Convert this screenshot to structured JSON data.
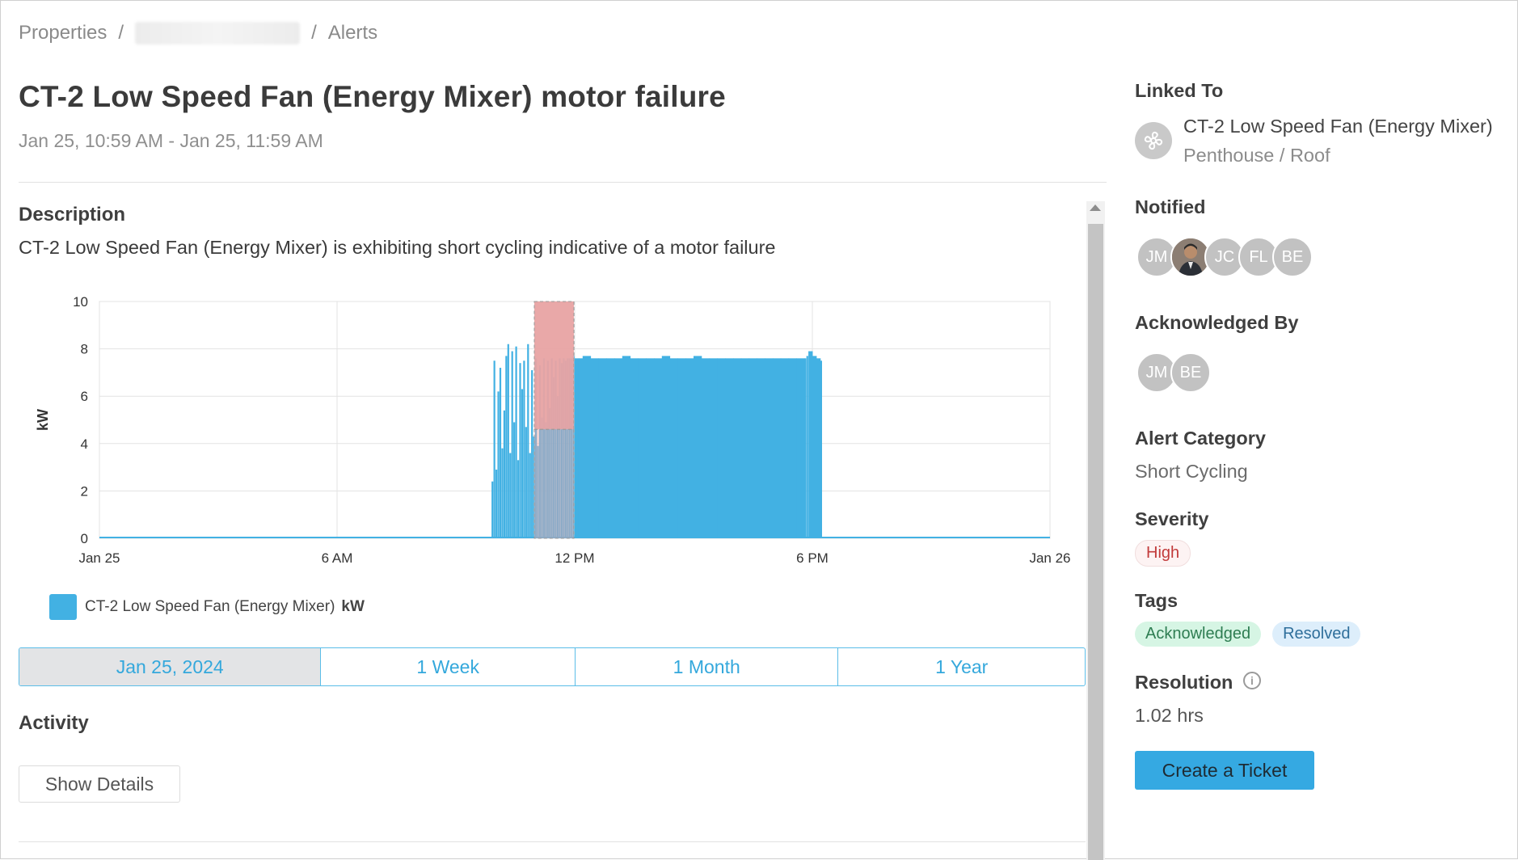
{
  "breadcrumb": {
    "root": "Properties",
    "separator": "/",
    "current": "Alerts"
  },
  "alert": {
    "title": "CT-2 Low Speed Fan (Energy Mixer) motor failure",
    "date_range": "Jan 25, 10:59 AM - Jan 25, 11:59 AM",
    "description_heading": "Description",
    "description": "CT-2 Low Speed Fan (Energy Mixer) is exhibiting short cycling indicative of a motor failure"
  },
  "chart_data": {
    "type": "bar",
    "ylabel": "kW",
    "ylim": [
      0,
      10
    ],
    "yticks": [
      "0",
      "2",
      "4",
      "6",
      "8",
      "10"
    ],
    "xticks": [
      "Jan 25",
      "6 AM",
      "12 PM",
      "6 PM",
      "Jan 26"
    ],
    "x_domain_hours": [
      0,
      24
    ],
    "highlight_window_hours": [
      10.98,
      11.98
    ],
    "series": [
      {
        "name": "CT-2 Low Speed Fan (Energy Mixer)",
        "unit": "kW",
        "color": "#42b1e3",
        "x_hours": [
          9.9,
          9.95,
          10.0,
          10.05,
          10.1,
          10.15,
          10.2,
          10.25,
          10.3,
          10.35,
          10.4,
          10.45,
          10.5,
          10.55,
          10.6,
          10.65,
          10.7,
          10.75,
          10.8,
          10.85,
          10.9,
          10.95,
          11.0,
          11.05,
          11.1,
          11.15,
          11.2,
          11.25,
          11.3,
          11.35,
          11.4,
          11.45,
          11.5,
          11.55,
          11.6,
          11.65,
          11.7,
          11.75,
          11.8,
          11.85,
          11.9,
          11.95,
          12.0,
          12.1,
          12.2,
          12.4,
          12.6,
          12.8,
          13.0,
          13.2,
          13.4,
          13.6,
          13.8,
          14.0,
          14.2,
          14.4,
          14.6,
          14.8,
          15.0,
          15.2,
          15.4,
          15.6,
          15.8,
          16.0,
          16.2,
          16.4,
          16.6,
          16.8,
          17.0,
          17.2,
          17.4,
          17.6,
          17.8,
          17.85,
          17.9,
          18.0,
          18.1,
          18.2
        ],
        "values": [
          2.4,
          7.5,
          2.9,
          6.2,
          7.2,
          3.8,
          5.4,
          7.7,
          8.2,
          3.6,
          7.9,
          4.9,
          8.1,
          3.3,
          7.4,
          6.3,
          7.5,
          4.7,
          8.2,
          3.6,
          7.1,
          4.3,
          7.6,
          3.9,
          7.3,
          5.1,
          7.6,
          4.9,
          7.5,
          5.5,
          7.6,
          6.8,
          7.5,
          6.0,
          7.6,
          7.4,
          7.6,
          7.5,
          7.6,
          7.6,
          7.6,
          7.7,
          7.6,
          7.6,
          7.7,
          7.6,
          7.6,
          7.6,
          7.6,
          7.7,
          7.6,
          7.6,
          7.6,
          7.6,
          7.7,
          7.6,
          7.6,
          7.6,
          7.7,
          7.6,
          7.6,
          7.6,
          7.6,
          7.6,
          7.6,
          7.6,
          7.6,
          7.6,
          7.6,
          7.6,
          7.6,
          7.6,
          7.6,
          7.7,
          7.9,
          7.7,
          7.6,
          7.5
        ]
      }
    ],
    "grid": true,
    "legend": "bottom-left"
  },
  "range_tabs": {
    "items": [
      "Jan 25, 2024",
      "1 Week",
      "1 Month",
      "1 Year"
    ],
    "active": "Jan 25, 2024"
  },
  "activity": {
    "heading": "Activity",
    "show_details_label": "Show Details"
  },
  "sidebar": {
    "linked_to_label": "Linked To",
    "linked_name": "CT-2 Low Speed Fan (Energy Mixer)",
    "linked_location": "Penthouse / Roof",
    "linked_icon": "fan-icon",
    "notified_label": "Notified",
    "notified": [
      "JM",
      "",
      "JC",
      "FL",
      "BE"
    ],
    "acknowledged_label": "Acknowledged By",
    "acknowledged": [
      "JM",
      "BE"
    ],
    "category_label": "Alert Category",
    "category": "Short Cycling",
    "severity_label": "Severity",
    "severity": "High",
    "tags_label": "Tags",
    "tags": [
      "Acknowledged",
      "Resolved"
    ],
    "resolution_label": "Resolution",
    "resolution": "1.02 hrs",
    "info_icon_glyph": "i",
    "create_ticket_label": "Create a Ticket"
  },
  "colors": {
    "accent": "#35a9e2",
    "series": "#42b1e3",
    "highlight": "#e8a3a3",
    "severity_high": "#c23b3b"
  }
}
